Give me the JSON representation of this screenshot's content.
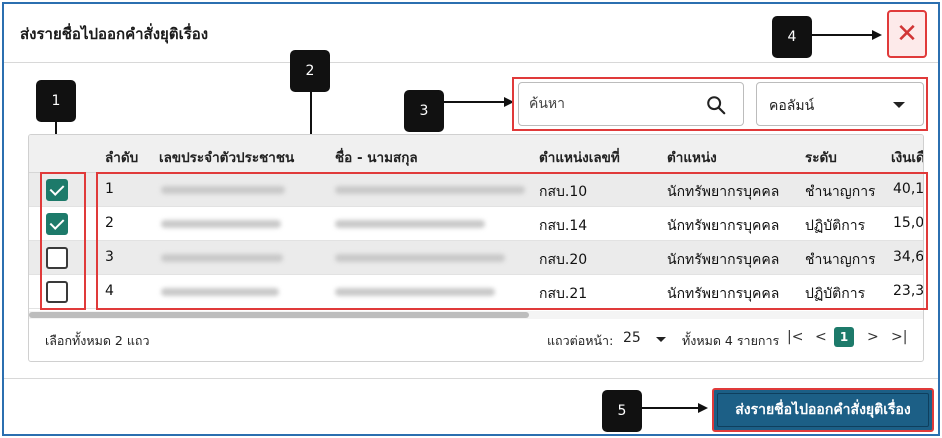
{
  "dialog": {
    "title": "ส่งรายชื่อไปออกคำสั่งยุติเรื่อง",
    "close_icon": "close-icon"
  },
  "callouts": [
    "1",
    "2",
    "3",
    "4",
    "5"
  ],
  "search": {
    "placeholder": "ค้นหา",
    "icon": "search-icon"
  },
  "column_filter": {
    "label": "คอลัมน์"
  },
  "table": {
    "headers": [
      "ลำดับ",
      "เลขประจำตัวประชาชน",
      "ชื่อ - นามสกุล",
      "ตำแหน่งเลขที่",
      "ตำแหน่ง",
      "ระดับ",
      "เงินเดื"
    ],
    "rows": [
      {
        "checked": true,
        "no": "1",
        "position_no": "กสบ.10",
        "position": "นักทรัพยากรบุคคล",
        "level": "ชำนาญการ",
        "salary": "40,1"
      },
      {
        "checked": true,
        "no": "2",
        "position_no": "กสบ.14",
        "position": "นักทรัพยากรบุคคล",
        "level": "ปฏิบัติการ",
        "salary": "15,0"
      },
      {
        "checked": false,
        "no": "3",
        "position_no": "กสบ.20",
        "position": "นักทรัพยากรบุคคล",
        "level": "ชำนาญการ",
        "salary": "34,6"
      },
      {
        "checked": false,
        "no": "4",
        "position_no": "กสบ.21",
        "position": "นักทรัพยากรบุคคล",
        "level": "ปฏิบัติการ",
        "salary": "23,3"
      }
    ]
  },
  "footer": {
    "selected_text": "เลือกทั้งหมด 2 แถว",
    "rows_per_page_label": "แถวต่อหน้า:",
    "rows_per_page_value": "25",
    "total_label": "ทั้งหมด 4 รายการ",
    "first_page_icon": "|<",
    "prev_page_icon": "<",
    "current_page": "1",
    "next_page_icon": ">",
    "last_page_icon": ">|"
  },
  "submit_button": {
    "label": "ส่งรายชื่อไปออกคำสั่งยุติเรื่อง"
  },
  "colors": {
    "accent": "#1d7a6a",
    "primary_button": "#1c5f86",
    "highlight_border": "#e03a3a"
  }
}
